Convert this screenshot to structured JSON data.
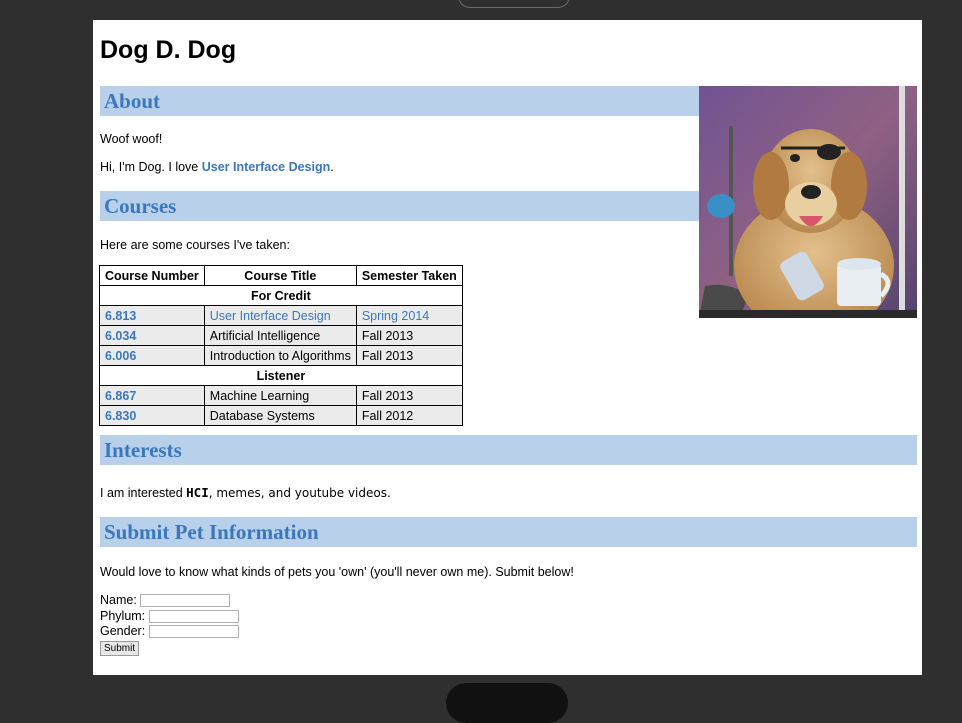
{
  "page": {
    "heading": "Dog D. Dog",
    "sections": {
      "about": "About",
      "courses": "Courses",
      "interests": "Interests",
      "submit": "Submit Pet Information"
    },
    "about": {
      "line1": "Woof woof!",
      "line2_prefix": "Hi, I'm Dog. I love ",
      "line2_link": "User Interface Design",
      "line2_suffix": "."
    },
    "courses_intro": "Here are some courses I've taken:",
    "table": {
      "headers": [
        "Course Number",
        "Course Title",
        "Semester Taken"
      ],
      "groups": [
        {
          "label": "For Credit",
          "rows": [
            {
              "num": "6.813",
              "title": "User Interface Design",
              "sem": "Spring 2014"
            },
            {
              "num": "6.034",
              "title": "Artificial Intelligence",
              "sem": "Fall 2013"
            },
            {
              "num": "6.006",
              "title": "Introduction to Algorithms",
              "sem": "Fall 2013"
            }
          ]
        },
        {
          "label": "Listener",
          "rows": [
            {
              "num": "6.867",
              "title": "Machine Learning",
              "sem": "Fall 2013"
            },
            {
              "num": "6.830",
              "title": "Database Systems",
              "sem": "Fall 2012"
            }
          ]
        }
      ]
    },
    "interests": {
      "prefix": "I am interested ",
      "hci": "HCI",
      "rest": ", memes, and youtube videos."
    },
    "submit_intro": "Would love to know what kinds of pets you 'own' (you'll never own me). Submit below!",
    "form": {
      "name_label": "Name:",
      "phylum_label": "Phylum:",
      "gender_label": "Gender:",
      "name_value": "",
      "phylum_value": "",
      "gender_value": "",
      "submit_label": "Submit"
    },
    "colors": {
      "accent": "#3a78bd",
      "section_bg": "#b8d0ea",
      "outer_bg": "#2f2f2f"
    }
  }
}
